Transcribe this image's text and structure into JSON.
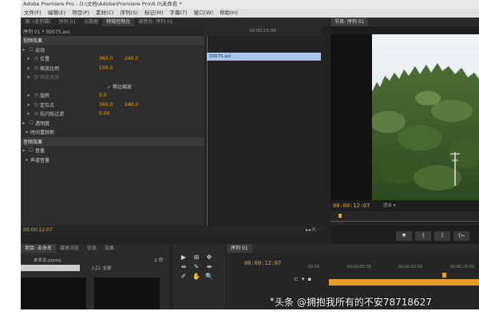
{
  "app": {
    "title": "Adobe Premiere Pro - D:\\文档\\Adobe\\Premiere Pro\\6.0\\未命名 *"
  },
  "menu": [
    "文件(F)",
    "编辑(E)",
    "项目(P)",
    "素材(C)",
    "序列(S)",
    "标记(M)",
    "字幕(T)",
    "窗口(W)",
    "帮助(H)"
  ],
  "top_tabs": {
    "left": [
      {
        "label": "源: (无剪辑)",
        "active": false
      },
      {
        "label": "序列 01",
        "active": false
      },
      {
        "label": "元数据",
        "active": false
      },
      {
        "label": "特效控制台",
        "active": true
      },
      {
        "label": "调音台: 序列 01",
        "active": false
      }
    ],
    "right": [
      {
        "label": "节目: 序列 01",
        "active": true
      }
    ]
  },
  "effect_controls": {
    "header": "序列 01 * 00075.avi",
    "rows": [
      {
        "type": "section",
        "label": "视频效果"
      },
      {
        "type": "fx",
        "label": "运动",
        "reset": true
      },
      {
        "type": "param",
        "label": "位置",
        "v1": "360.0",
        "v2": "240.0"
      },
      {
        "type": "param",
        "label": "缩放比例",
        "v1": "100.0",
        "v2": ""
      },
      {
        "type": "param-dim",
        "label": "缩放宽度",
        "v1": "",
        "v2": ""
      },
      {
        "type": "check",
        "label": "等比缩放"
      },
      {
        "type": "param",
        "label": "旋转",
        "v1": "0.0",
        "v2": ""
      },
      {
        "type": "param",
        "label": "定位点",
        "v1": "360.0",
        "v2": "240.0"
      },
      {
        "type": "param",
        "label": "抗闪烁过滤",
        "v1": "0.00",
        "v2": ""
      },
      {
        "type": "fx",
        "label": "透明度",
        "reset": true
      },
      {
        "type": "sub",
        "label": "时间重映射"
      },
      {
        "type": "section",
        "label": "音频效果"
      },
      {
        "type": "fx",
        "label": "音量",
        "reset": true
      },
      {
        "type": "sub",
        "label": "声道音量"
      }
    ],
    "timecode": "00:00:12:07",
    "mini_timeline": {
      "ruler_label": "00:00:15:00",
      "clip_label": "00075.avi"
    }
  },
  "program_monitor": {
    "timecode": "00:00:12:07",
    "fit_label": "适合"
  },
  "project_panel": {
    "tabs": [
      {
        "label": "项目: 未命名",
        "active": true
      },
      {
        "label": "媒体浏览",
        "active": false
      },
      {
        "label": "信息",
        "active": false
      },
      {
        "label": "效果",
        "active": false
      }
    ],
    "project_name": "未命名.prproj",
    "item_count": "2 项",
    "in_label": "入口: 全部"
  },
  "tools": [
    "▶",
    "⊞",
    "✥",
    "⇹",
    "✎",
    "⇼",
    "✐",
    "✋",
    "🔍"
  ],
  "timeline": {
    "tab": "序列 01",
    "timecode": "00:00:12:07",
    "ruler": [
      "00:00",
      "00:00:05:00",
      "00:00:10:00",
      "00:00:15:00"
    ]
  },
  "watermark": "头条 @拥抱我所有的不安78718627",
  "colors": {
    "accent_timecode": "#e8a12a",
    "clip_blue": "#a9c6e8",
    "playhead_red": "#c0392b"
  }
}
